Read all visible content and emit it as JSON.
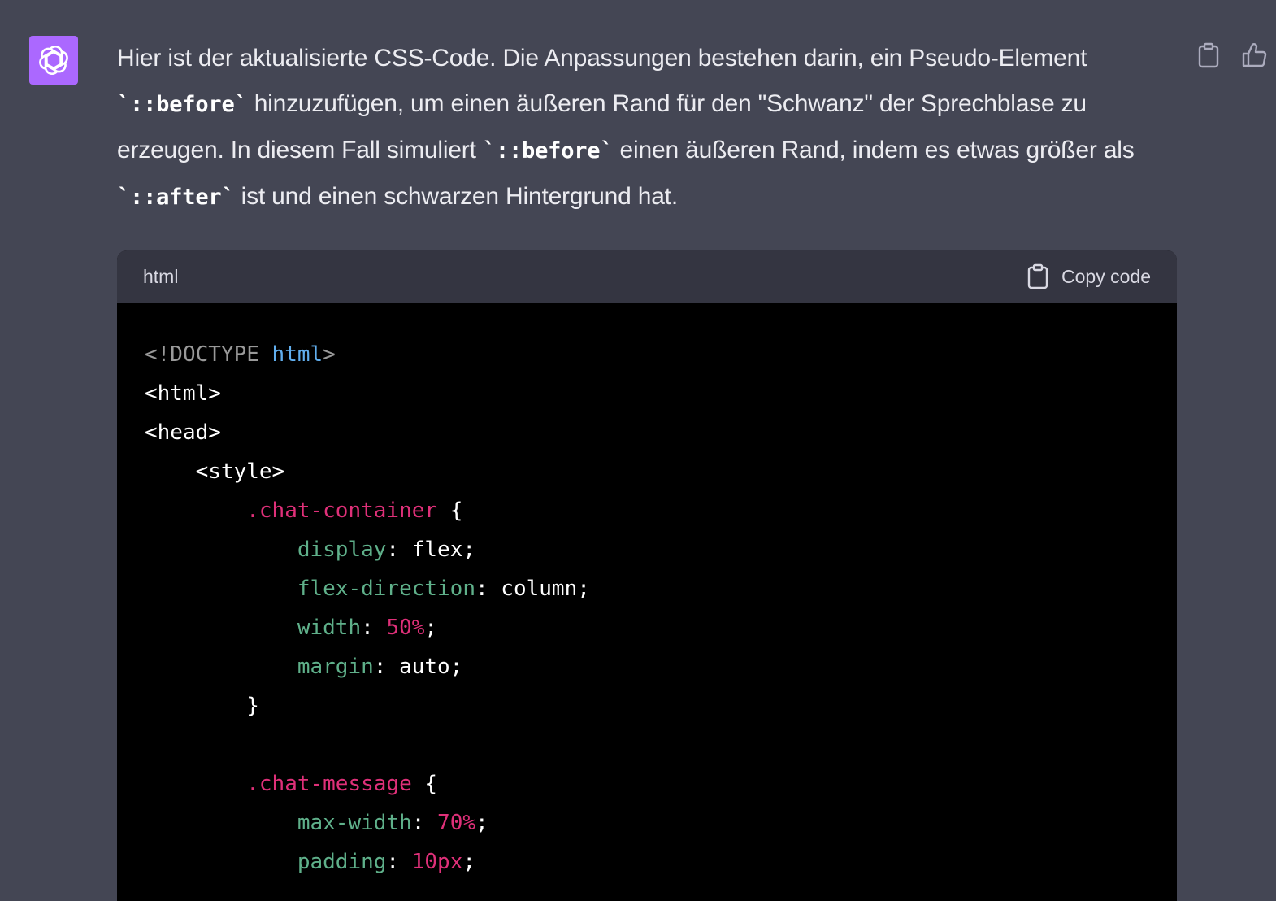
{
  "message": {
    "avatar_icon": "openai-logo-icon",
    "paragraph": [
      {
        "type": "text",
        "value": "Hier ist der aktualisierte CSS-Code. Die Anpassungen bestehen darin, ein Pseudo-Element "
      },
      {
        "type": "code",
        "value": "`::before`"
      },
      {
        "type": "text",
        "value": " hinzuzufügen, um einen äußeren Rand für den \"Schwanz\" der Sprechblase zu erzeugen. In diesem Fall simuliert "
      },
      {
        "type": "code",
        "value": "`::before`"
      },
      {
        "type": "text",
        "value": " einen äußeren Rand, indem es etwas größer als "
      },
      {
        "type": "code",
        "value": "`::after`"
      },
      {
        "type": "text",
        "value": " ist und einen schwarzen Hintergrund hat."
      }
    ],
    "actions": [
      {
        "name": "copy-message-button",
        "icon": "clipboard-icon"
      },
      {
        "name": "thumbs-up-button",
        "icon": "thumbs-up-icon"
      }
    ]
  },
  "code_block": {
    "language": "html",
    "copy_label": "Copy code",
    "colors": {
      "header_bg": "#343541",
      "body_bg": "#000000",
      "tag_gray": "#999999",
      "keyword_blue": "#61aeee",
      "selector_pink": "#df3079",
      "property_green": "#5fb08a"
    },
    "lines": [
      [
        {
          "t": "<!DOCTYPE ",
          "c": "gray"
        },
        {
          "t": "html",
          "c": "blue"
        },
        {
          "t": ">",
          "c": "gray"
        }
      ],
      [
        {
          "t": "<html>",
          "c": "white"
        }
      ],
      [
        {
          "t": "<head>",
          "c": "white"
        }
      ],
      [
        {
          "t": "    <style>",
          "c": "white"
        }
      ],
      [
        {
          "t": "        ",
          "c": "white"
        },
        {
          "t": ".chat-container",
          "c": "pink"
        },
        {
          "t": " {",
          "c": "white"
        }
      ],
      [
        {
          "t": "            ",
          "c": "white"
        },
        {
          "t": "display",
          "c": "green"
        },
        {
          "t": ": flex;",
          "c": "white"
        }
      ],
      [
        {
          "t": "            ",
          "c": "white"
        },
        {
          "t": "flex-direction",
          "c": "green"
        },
        {
          "t": ": column;",
          "c": "white"
        }
      ],
      [
        {
          "t": "            ",
          "c": "white"
        },
        {
          "t": "width",
          "c": "green"
        },
        {
          "t": ": ",
          "c": "white"
        },
        {
          "t": "50%",
          "c": "pink"
        },
        {
          "t": ";",
          "c": "white"
        }
      ],
      [
        {
          "t": "            ",
          "c": "white"
        },
        {
          "t": "margin",
          "c": "green"
        },
        {
          "t": ": auto;",
          "c": "white"
        }
      ],
      [
        {
          "t": "        }",
          "c": "white"
        }
      ],
      [
        {
          "t": "",
          "c": "white"
        }
      ],
      [
        {
          "t": "        ",
          "c": "white"
        },
        {
          "t": ".chat-message",
          "c": "pink"
        },
        {
          "t": " {",
          "c": "white"
        }
      ],
      [
        {
          "t": "            ",
          "c": "white"
        },
        {
          "t": "max-width",
          "c": "green"
        },
        {
          "t": ": ",
          "c": "white"
        },
        {
          "t": "70%",
          "c": "pink"
        },
        {
          "t": ";",
          "c": "white"
        }
      ],
      [
        {
          "t": "            ",
          "c": "white"
        },
        {
          "t": "padding",
          "c": "green"
        },
        {
          "t": ": ",
          "c": "white"
        },
        {
          "t": "10px",
          "c": "pink"
        },
        {
          "t": ";",
          "c": "white"
        }
      ]
    ]
  }
}
